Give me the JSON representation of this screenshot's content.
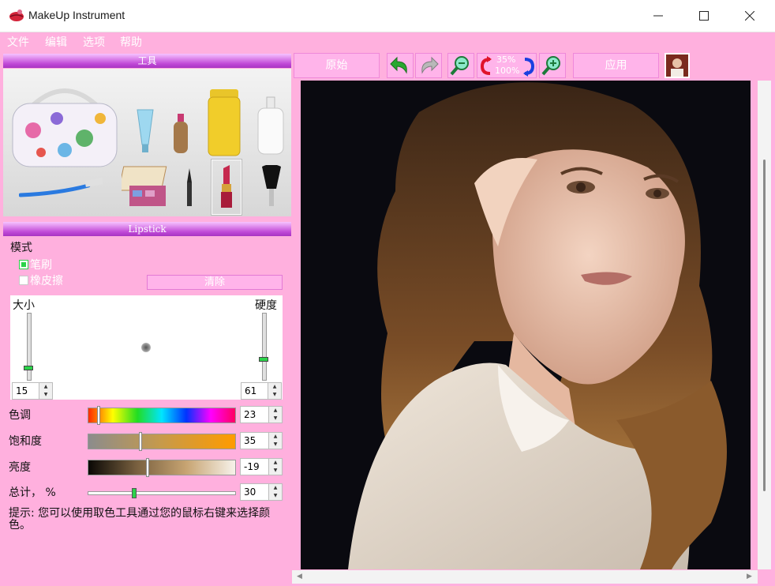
{
  "window": {
    "title": "MakeUp Instrument"
  },
  "menu": [
    "文件",
    "编辑",
    "选项",
    "帮助"
  ],
  "tools_panel": {
    "header": "工具"
  },
  "lipstick_panel": {
    "header": "Lipstick",
    "mode_label": "模式",
    "radio_brush": "笔刷",
    "radio_eraser": "橡皮擦",
    "clear_button": "清除",
    "size_label": "大小",
    "hardness_label": "硬度",
    "size_value": "15",
    "hardness_value": "61",
    "size_level": 0.15,
    "hardness_level": 0.3
  },
  "adjustments": {
    "hue": {
      "label": "色调",
      "value": "23",
      "level": 0.06
    },
    "saturation": {
      "label": "饱和度",
      "value": "35",
      "level": 0.35
    },
    "brightness": {
      "label": "亮度",
      "value": "-19",
      "level": 0.4
    },
    "total": {
      "label": "总计， %",
      "value": "30",
      "level": 0.3
    }
  },
  "tip": "提示: 您可以使用取色工具通过您的鼠标右键来选择颜色。",
  "toolbar": {
    "original_button": "原始",
    "apply_button": "应用",
    "zoom_top": "35%",
    "zoom_bottom": "100%"
  },
  "colors": {
    "pink": "#ffb0de",
    "header_purple": "#c14ad7",
    "accent_green": "#2bd34a"
  }
}
